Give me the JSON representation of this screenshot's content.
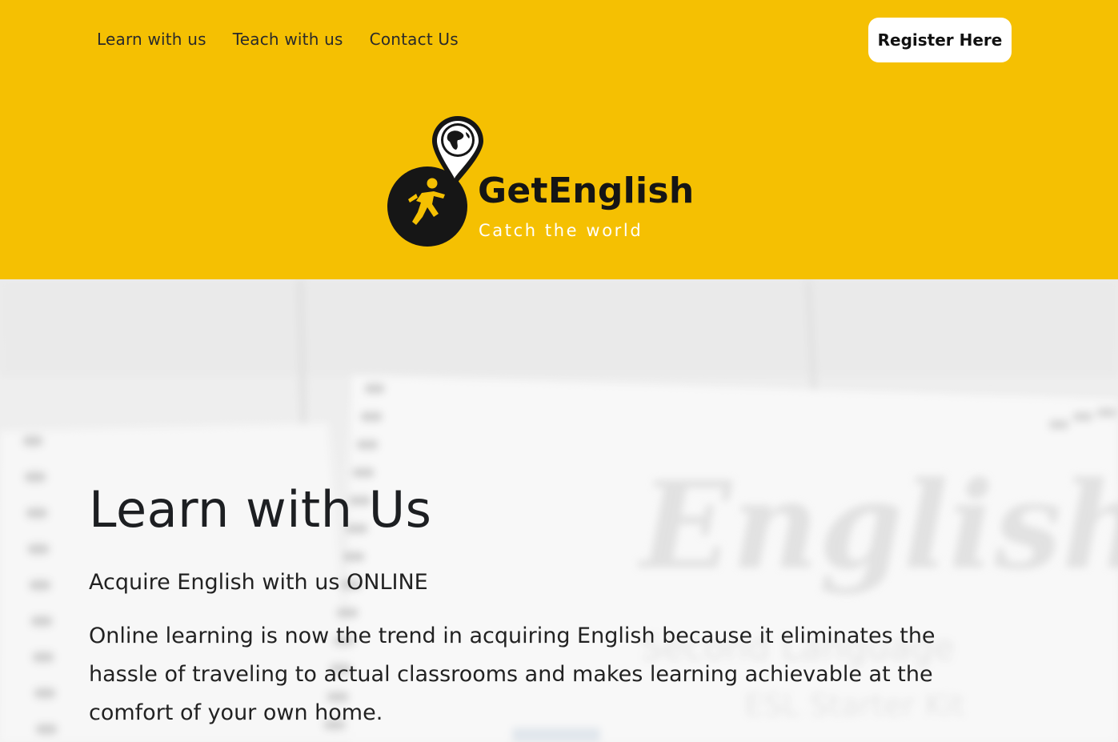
{
  "nav": {
    "items": [
      {
        "label": "Learn with us"
      },
      {
        "label": "Teach with us"
      },
      {
        "label": "Contact Us"
      }
    ],
    "register_label": "Register Here"
  },
  "brand": {
    "name": "GetEnglish",
    "tagline": "Catch the world",
    "logo_icon": "runner-globe-pin-icon"
  },
  "hero": {
    "title": "Learn with Us",
    "subtitle": "Acquire English with us ONLINE",
    "description": "Online learning is now the trend in acquiring English because it eliminates the hassle of traveling to actual classrooms and makes learning achievable at the comfort of your own home.",
    "background_script": "English",
    "background_caption_1": "Second Language",
    "background_caption_2": "ESL Starter Kit"
  },
  "colors": {
    "header_bg": "#f5c002",
    "button_bg": "#ffffff",
    "text_dark": "#212529"
  }
}
